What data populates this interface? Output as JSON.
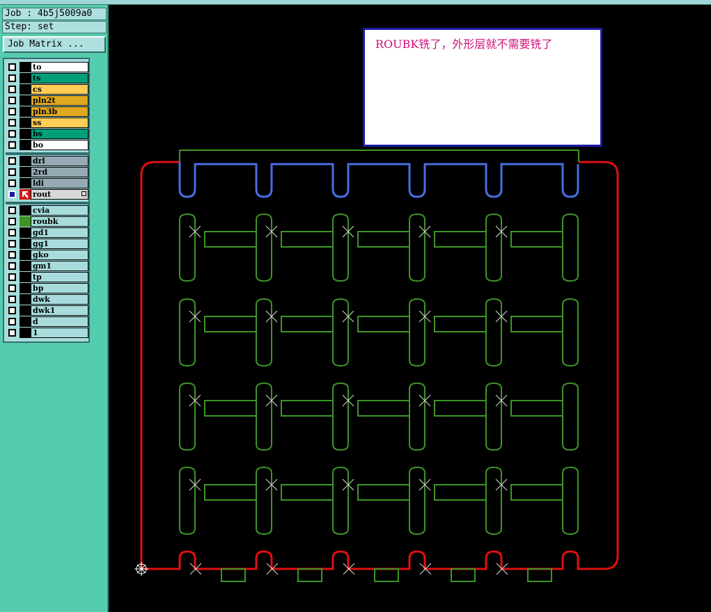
{
  "job_label": "Job : 4b5j5009a0",
  "step_label": "Step: set",
  "job_matrix_button": "Job Matrix ...",
  "layer_groups": [
    [
      {
        "name": "to",
        "color": "#ffffff"
      },
      {
        "name": "ts",
        "color": "#009f7a"
      },
      {
        "name": "cs",
        "color": "#ffcc55"
      },
      {
        "name": "pln2t",
        "color": "#e0a820"
      },
      {
        "name": "pln3b",
        "color": "#e0a820"
      },
      {
        "name": "ss",
        "color": "#ffcc55"
      },
      {
        "name": "bs",
        "color": "#009f7a"
      },
      {
        "name": "bo",
        "color": "#ffffff"
      }
    ],
    [
      {
        "name": "drl",
        "color": "#96aab4"
      },
      {
        "name": "2rd",
        "color": "#96aab4"
      },
      {
        "name": "ldi",
        "color": "#96aab4"
      },
      {
        "name": "rout",
        "color": "#d8d8d8",
        "active": true
      }
    ],
    [
      {
        "name": "cvia",
        "color": "#a8dcdc"
      },
      {
        "name": "roubk",
        "color": "#a8dcdc",
        "marked": true
      },
      {
        "name": "gd1",
        "color": "#a8dcdc"
      },
      {
        "name": "gg1",
        "color": "#a8dcdc"
      },
      {
        "name": "gko",
        "color": "#a8dcdc"
      },
      {
        "name": "gm1",
        "color": "#a8dcdc"
      },
      {
        "name": "tp",
        "color": "#a8dcdc"
      },
      {
        "name": "bp",
        "color": "#a8dcdc"
      },
      {
        "name": "dwk",
        "color": "#a8dcdc"
      },
      {
        "name": "dwk1",
        "color": "#a8dcdc"
      },
      {
        "name": "d",
        "color": "#a8dcdc"
      },
      {
        "name": "1",
        "color": "#a8dcdc"
      }
    ]
  ],
  "note_text": "ROUBK铣了，外形层就不需要铣了",
  "colors": {
    "outline": "#e01010",
    "slots": "#4a6ee0",
    "parts": "#3c9626",
    "marker": "#e0e0e0",
    "note_text": "#d0107a",
    "note_border": "#1a1aa8"
  },
  "icons": {
    "origin": "crosshair-origin-icon",
    "active_layer": "arrow-cursor-icon"
  }
}
